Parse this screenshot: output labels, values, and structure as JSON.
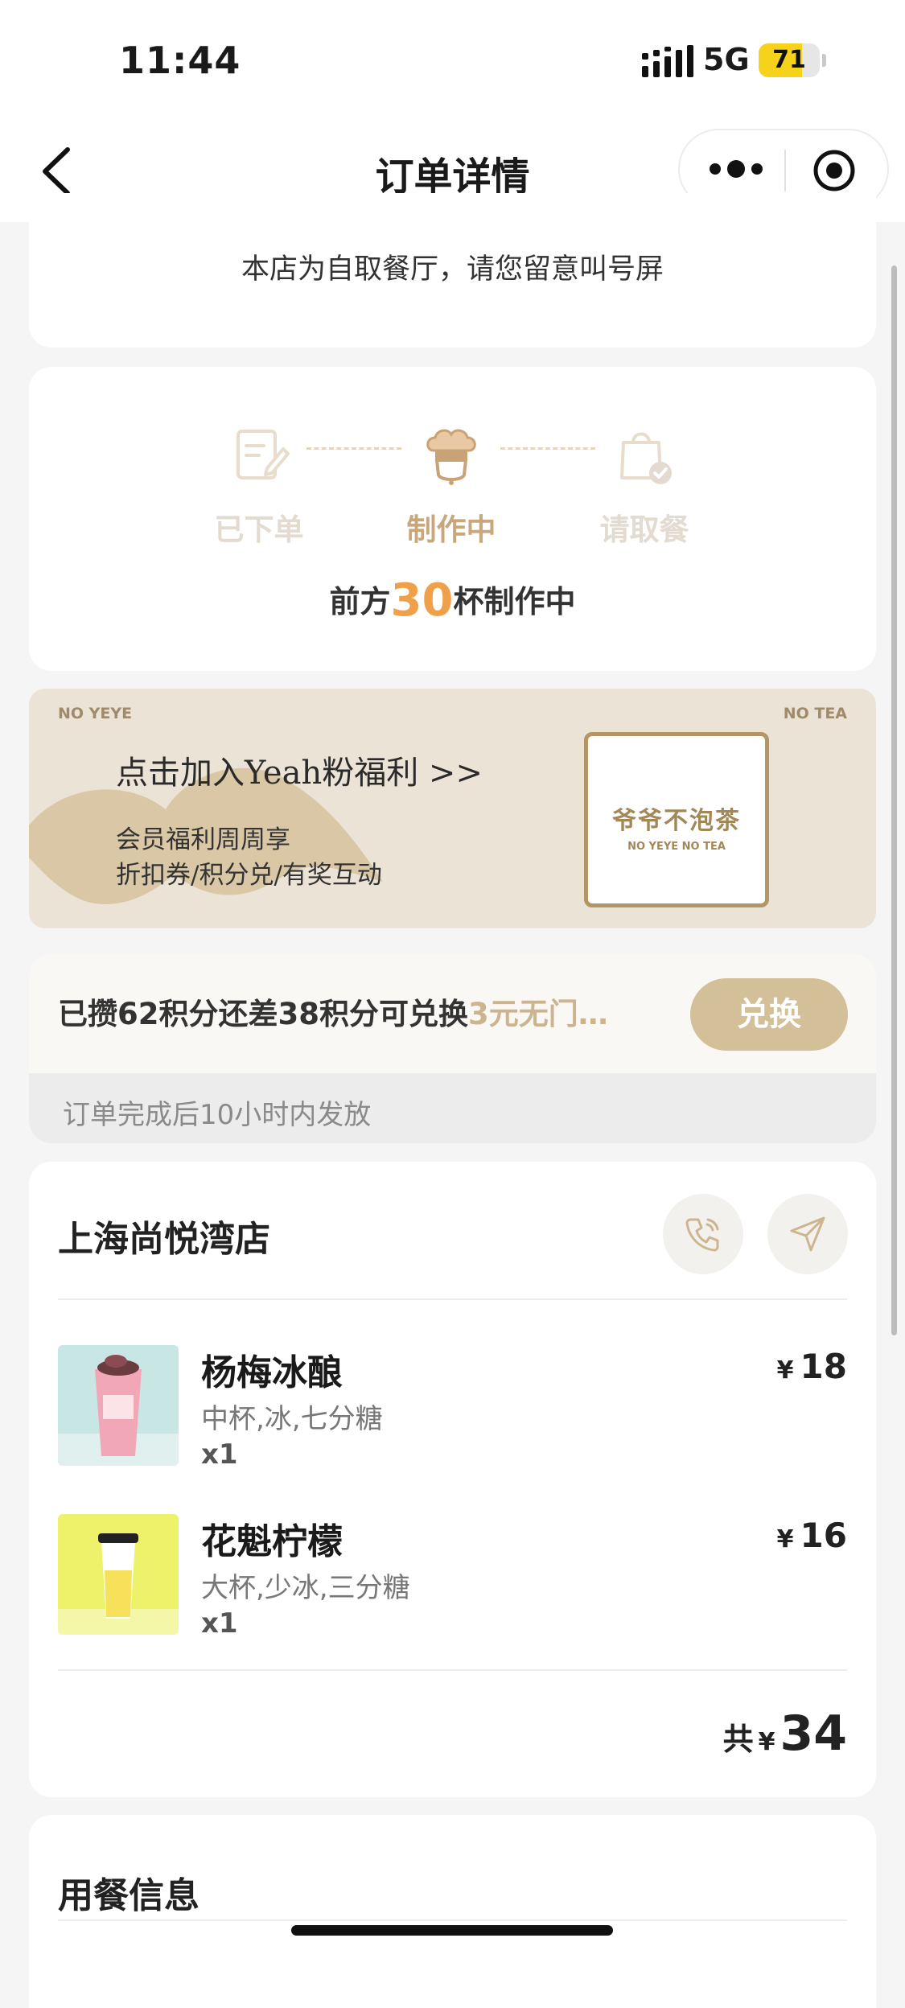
{
  "status_bar": {
    "time": "11:44",
    "network": "5G",
    "battery": "71",
    "battery_level": 0.71
  },
  "nav": {
    "title": "订单详情"
  },
  "notice": {
    "text": "本店为自取餐厅，请您留意叫号屏"
  },
  "progress": {
    "steps": [
      {
        "label": "已下单",
        "state": "done"
      },
      {
        "label": "制作中",
        "state": "active"
      },
      {
        "label": "请取餐",
        "state": "pending"
      }
    ],
    "queue_prefix": "前方",
    "queue_count": "30",
    "queue_suffix": "杯制作中"
  },
  "banner": {
    "tag_left": "NO YEYE",
    "tag_right": "NO TEA",
    "title": "点击加入Yeah粉福利 >>",
    "line1": "会员福利周周享",
    "line2": "折扣券/积分兑/有奖互动",
    "logo_cn": "爷爷不泡茶",
    "logo_en": "NO YEYE NO TEA"
  },
  "points": {
    "text_main": "已攒62积分还差38积分可兑换",
    "text_highlight": "3元无门…",
    "button": "兑换",
    "footnote": "订单完成后10小时内发放"
  },
  "order": {
    "store": "上海尚悦湾店",
    "items": [
      {
        "name": "杨梅冰酿",
        "options": "中杯,冰,七分糖",
        "qty": "x1",
        "price": "18"
      },
      {
        "name": "花魁柠檬",
        "options": "大杯,少冰,三分糖",
        "qty": "x1",
        "price": "16"
      }
    ],
    "currency": "¥",
    "total_label": "共",
    "total": "34"
  },
  "dining": {
    "title": "用餐信息"
  },
  "colors": {
    "accent": "#d3bf98",
    "orange": "#f1a04a",
    "banner_bg": "#ebe3d6",
    "logo_gold": "#a38857"
  }
}
